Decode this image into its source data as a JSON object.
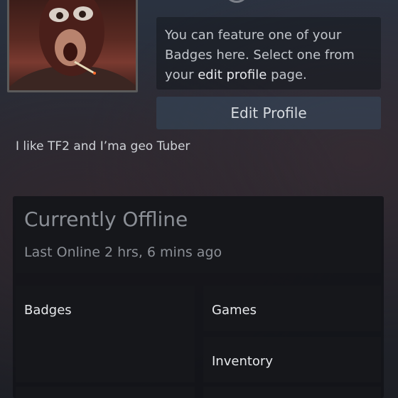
{
  "profile": {
    "badge_note_lines": [
      "You can feature one of your",
      "Badges here. Select one from"
    ],
    "badge_note_prefix": "your ",
    "badge_note_link": "edit profile",
    "badge_note_suffix": " page.",
    "edit_profile_label": "Edit Profile",
    "summary": "I like TF2 and I’ma geo Tuber"
  },
  "status": {
    "title": "Currently Offline",
    "last_online": "Last Online 2 hrs, 6 mins ago"
  },
  "tiles": {
    "badges": "Badges",
    "games": "Games",
    "inventory": "Inventory"
  }
}
